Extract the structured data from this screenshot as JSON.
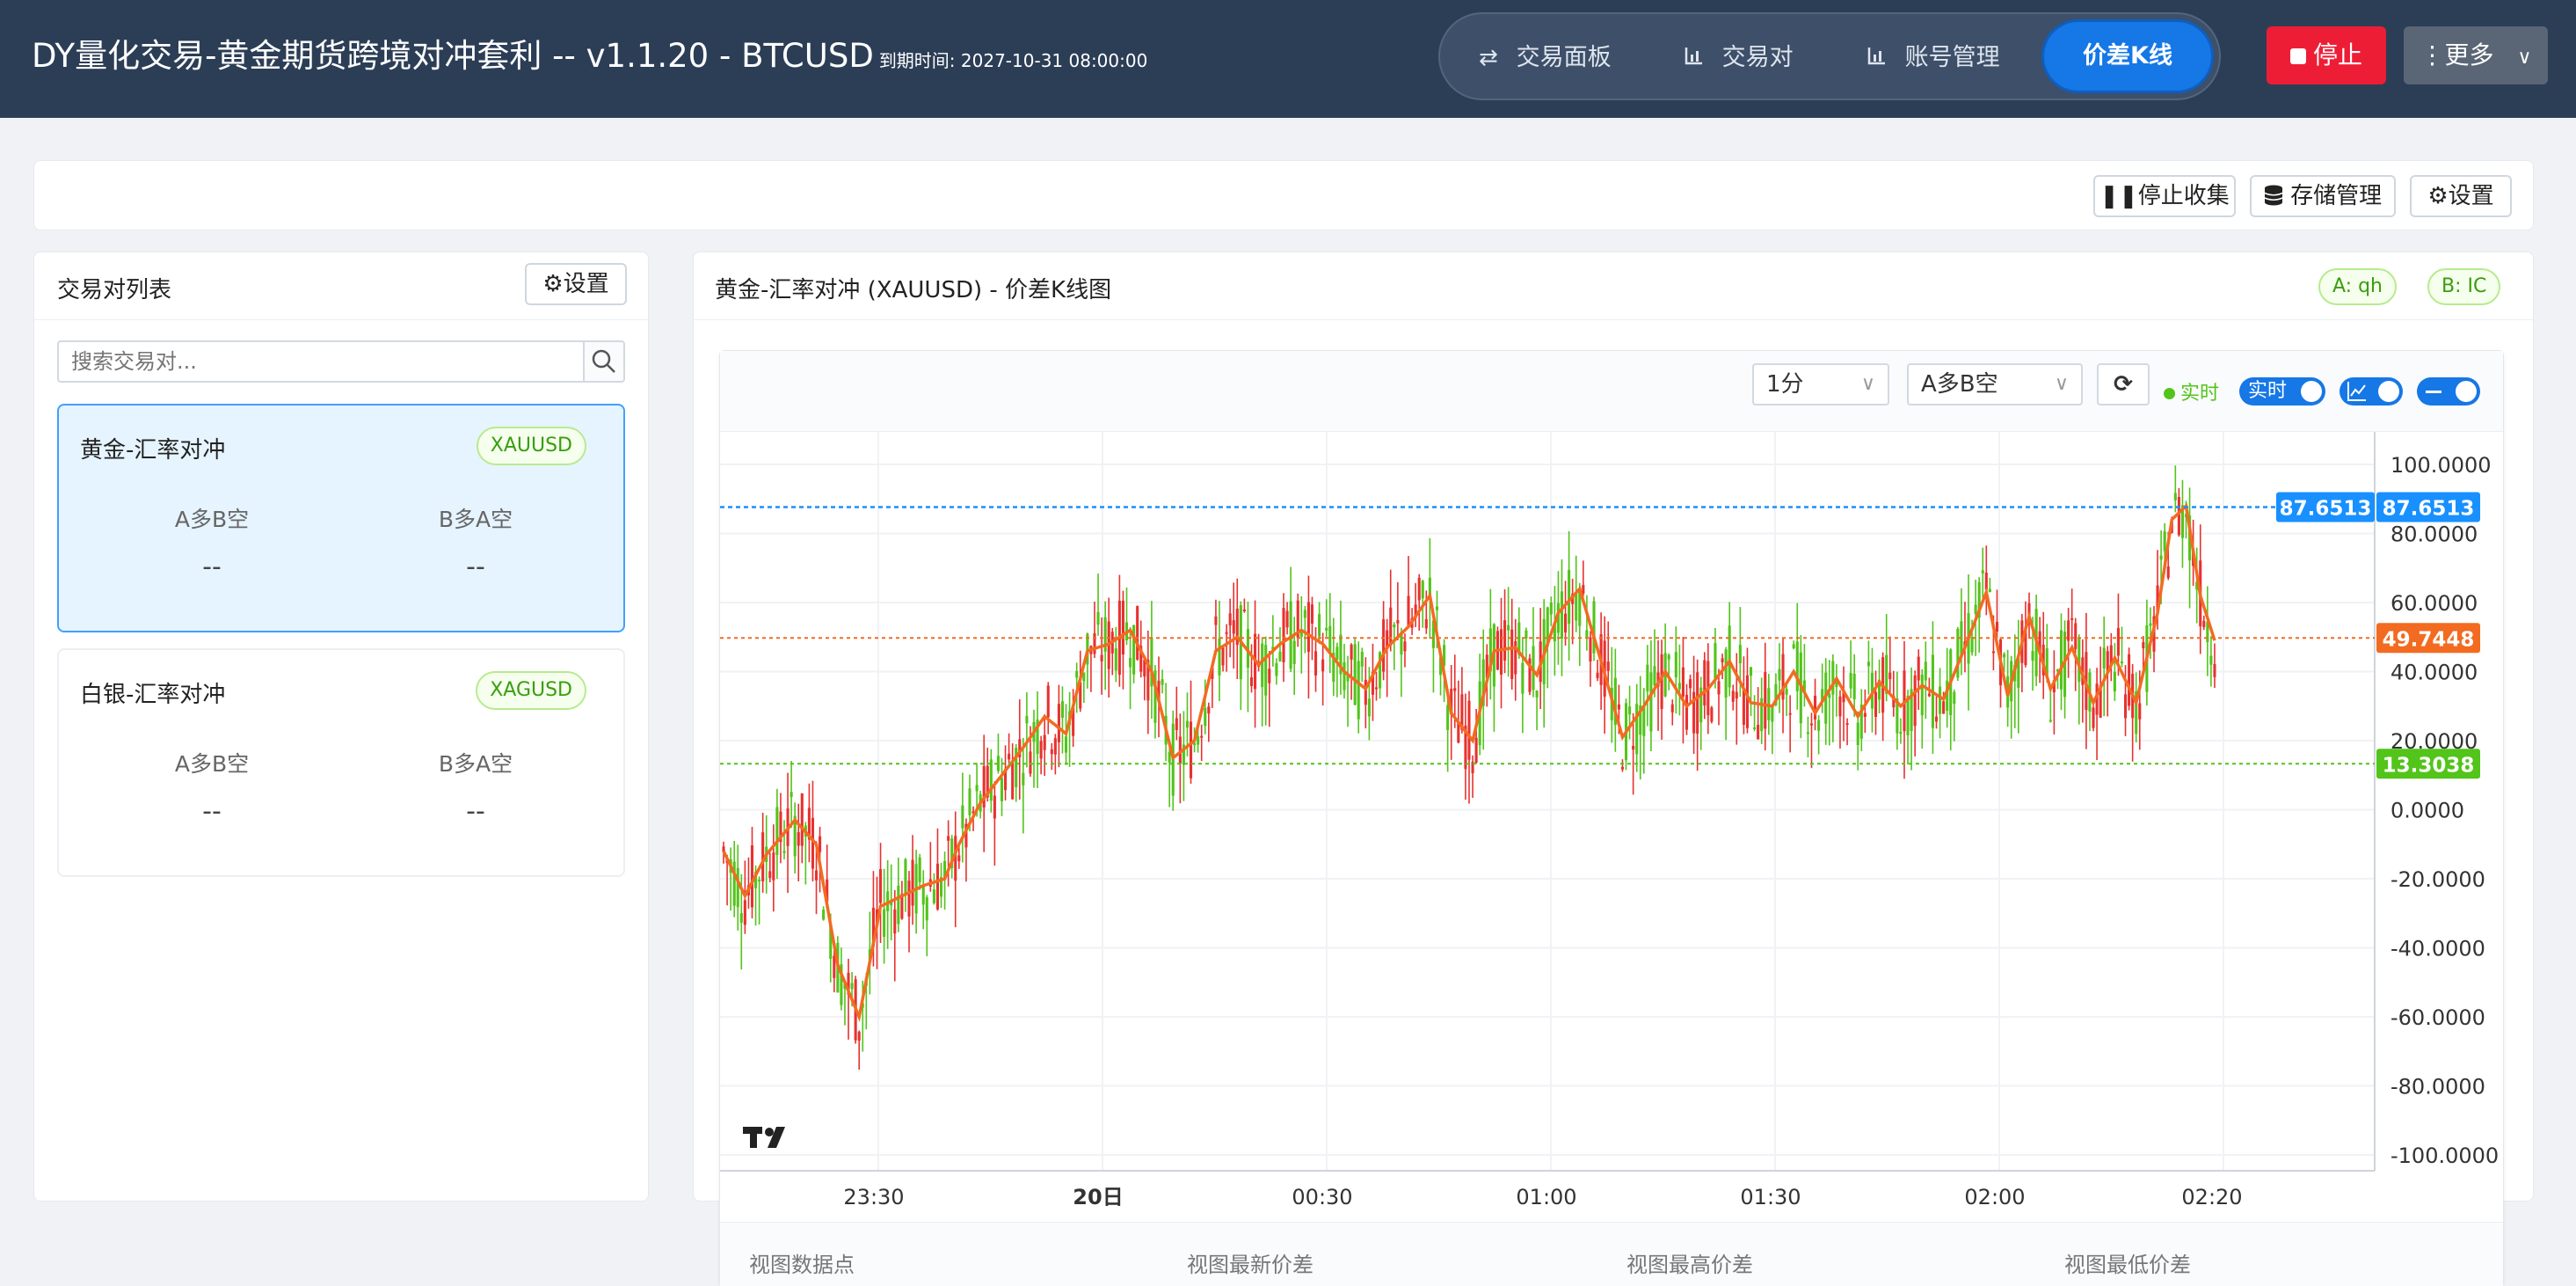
{
  "header": {
    "title": "DY量化交易-黄金期货跨境对冲套利   -- v1.1.20 - BTCUSD",
    "expire": "到期时间: 2027-10-31 08:00:00",
    "nav": [
      {
        "label": "交易面板",
        "icon": "swap-icon"
      },
      {
        "label": "交易对",
        "icon": "bar-chart-icon"
      },
      {
        "label": "账号管理",
        "icon": "bar-chart-icon"
      }
    ],
    "nav_active": "价差K线",
    "stop_label": "停止",
    "more_label": "更多"
  },
  "toolbar": {
    "stop_collect": "停止收集",
    "storage": "存储管理",
    "settings": "设置"
  },
  "left": {
    "title": "交易对列表",
    "settings": "设置",
    "search_placeholder": "搜索交易对...",
    "pairs": [
      {
        "name": "黄金-汇率对冲",
        "tag": "XAUUSD",
        "dir_a": "A多B空",
        "dir_b": "B多A空",
        "val_a": "--",
        "val_b": "--"
      },
      {
        "name": "白银-汇率对冲",
        "tag": "XAGUSD",
        "dir_a": "A多B空",
        "dir_b": "B多A空",
        "val_a": "--",
        "val_b": "--"
      }
    ]
  },
  "chart_panel": {
    "title": "黄金-汇率对冲 (XAUUSD) - 价差K线图",
    "tag_a": "A: qh",
    "tag_b": "B: IC",
    "interval": "1分",
    "direction": "A多B空",
    "realtime_label": "实时",
    "toggle_label": "实时",
    "stats": [
      "视图数据点",
      "视图最新价差",
      "视图最高价差",
      "视图最低价差"
    ]
  },
  "colors": {
    "up": "#e8312f",
    "down": "#52c41a",
    "ma": "#f26b21",
    "high_line": "#1890ff",
    "last_line": "#f26b21",
    "low_line": "#52c41a"
  },
  "chart_data": {
    "type": "candlestick",
    "y_ticks": [
      "100.0000",
      "80.0000",
      "60.0000",
      "40.0000",
      "20.0000",
      "0.0000",
      "-20.0000",
      "-40.0000",
      "-60.0000",
      "-80.0000",
      "-100.0000"
    ],
    "ylim": [
      -100,
      100
    ],
    "x_ticks": [
      "23:30",
      "20日",
      "00:30",
      "01:00",
      "01:30",
      "02:00",
      "02:20"
    ],
    "markers": {
      "high": "87.6513",
      "high_left": "87.6513",
      "last": "49.7448",
      "low": "13.3038"
    },
    "marker_values": {
      "high": 87.6513,
      "last": 49.7448,
      "low": 13.3038
    },
    "ma_anchors": [
      [
        0,
        -12
      ],
      [
        6,
        -25
      ],
      [
        12,
        -13
      ],
      [
        20,
        -3
      ],
      [
        26,
        -10
      ],
      [
        32,
        -45
      ],
      [
        38,
        -60
      ],
      [
        44,
        -28
      ],
      [
        50,
        -25
      ],
      [
        56,
        -22
      ],
      [
        62,
        -20
      ],
      [
        66,
        -10
      ],
      [
        72,
        2
      ],
      [
        78,
        10
      ],
      [
        84,
        18
      ],
      [
        90,
        27
      ],
      [
        96,
        22
      ],
      [
        102,
        46
      ],
      [
        108,
        48
      ],
      [
        114,
        52
      ],
      [
        120,
        40
      ],
      [
        126,
        15
      ],
      [
        132,
        20
      ],
      [
        138,
        46
      ],
      [
        144,
        50
      ],
      [
        150,
        42
      ],
      [
        156,
        48
      ],
      [
        162,
        52
      ],
      [
        168,
        48
      ],
      [
        174,
        40
      ],
      [
        180,
        35
      ],
      [
        186,
        47
      ],
      [
        192,
        53
      ],
      [
        198,
        62
      ],
      [
        204,
        28
      ],
      [
        210,
        20
      ],
      [
        216,
        46
      ],
      [
        222,
        47
      ],
      [
        228,
        39
      ],
      [
        234,
        57
      ],
      [
        240,
        64
      ],
      [
        246,
        43
      ],
      [
        252,
        21
      ],
      [
        258,
        30
      ],
      [
        264,
        40
      ],
      [
        270,
        30
      ],
      [
        276,
        35
      ],
      [
        282,
        43
      ],
      [
        288,
        31
      ],
      [
        294,
        30
      ],
      [
        300,
        40
      ],
      [
        306,
        28
      ],
      [
        312,
        38
      ],
      [
        318,
        27
      ],
      [
        324,
        37
      ],
      [
        330,
        30
      ],
      [
        336,
        36
      ],
      [
        342,
        32
      ],
      [
        348,
        47
      ],
      [
        354,
        63
      ],
      [
        360,
        33
      ],
      [
        366,
        56
      ],
      [
        372,
        35
      ],
      [
        378,
        47
      ],
      [
        384,
        31
      ],
      [
        390,
        44
      ],
      [
        396,
        31
      ],
      [
        402,
        57
      ],
      [
        406,
        84
      ],
      [
        410,
        88
      ],
      [
        414,
        62
      ],
      [
        418,
        49
      ]
    ],
    "candle_count": 419
  }
}
